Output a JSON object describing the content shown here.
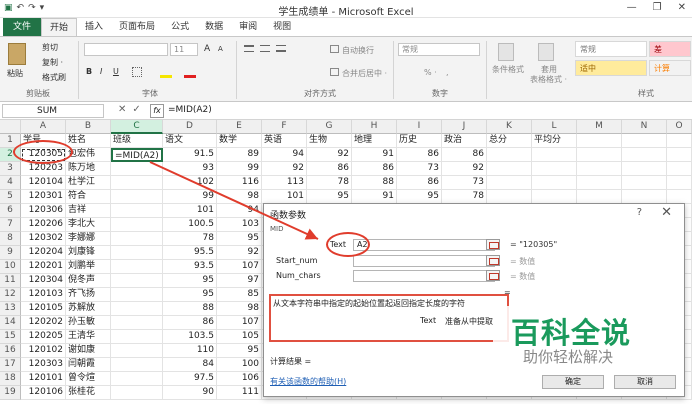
{
  "window": {
    "title": "学生成绩单 - Microsoft Excel",
    "minimize": "—",
    "restore": "❐",
    "close": "✕"
  },
  "qat": {
    "save": "▣",
    "undo": "↶",
    "redo": "↷",
    "more": "▾"
  },
  "tabs": [
    "文件",
    "开始",
    "插入",
    "页面布局",
    "公式",
    "数据",
    "审阅",
    "视图"
  ],
  "ribbon": {
    "paste": "粘贴",
    "cut": "剪切",
    "copy": "复制 ·",
    "format_painter": "格式刷",
    "font_size": "11",
    "bold": "B",
    "italic": "I",
    "underline": "U",
    "font_grow": "A",
    "font_shrink": "A",
    "wrap": "自动换行",
    "merge": "合并后居中 ·",
    "number_format": "常规",
    "percent": "% ·",
    "comma": ",",
    "cond_format": "条件格式",
    "table_format_1": "套用",
    "table_format_2": "表格格式 ·",
    "style_normal": "常规",
    "style_bad": "差",
    "style_neutral": "适中",
    "style_calc": "计算",
    "groups": {
      "clipboard": "剪贴板",
      "font": "字体",
      "align": "对齐方式",
      "number": "数字",
      "styles": "样式"
    }
  },
  "formula_bar": {
    "name_box": "SUM",
    "cancel": "✕",
    "enter": "✓",
    "fx": "fx",
    "formula": "=MID(A2)"
  },
  "columns": [
    "A",
    "B",
    "C",
    "D",
    "E",
    "F",
    "G",
    "H",
    "I",
    "J",
    "K",
    "L",
    "M",
    "N",
    "O"
  ],
  "rows": [
    [
      "学号",
      "姓名",
      "班级",
      "语文",
      "数学",
      "英语",
      "生物",
      "地理",
      "历史",
      "政治",
      "总分",
      "平均分"
    ],
    [
      "120305",
      "包宏伟",
      "=MID(A2)",
      "91.5",
      "89",
      "94",
      "92",
      "91",
      "86",
      "86",
      "",
      ""
    ],
    [
      "120203",
      "陈万地",
      "",
      "93",
      "99",
      "92",
      "86",
      "86",
      "73",
      "92",
      "",
      ""
    ],
    [
      "120104",
      "杜学江",
      "",
      "102",
      "116",
      "113",
      "78",
      "88",
      "86",
      "73",
      "",
      ""
    ],
    [
      "120301",
      "符合",
      "",
      "99",
      "98",
      "101",
      "95",
      "91",
      "95",
      "78",
      "",
      ""
    ],
    [
      "120306",
      "吉祥",
      "",
      "101",
      "94",
      "",
      "",
      "",
      "",
      "",
      "",
      ""
    ],
    [
      "120206",
      "李北大",
      "",
      "100.5",
      "103",
      "",
      "",
      "",
      "",
      "",
      "",
      ""
    ],
    [
      "120302",
      "李娜娜",
      "",
      "78",
      "95",
      "",
      "",
      "",
      "",
      "",
      "",
      ""
    ],
    [
      "120204",
      "刘康锋",
      "",
      "95.5",
      "92",
      "",
      "",
      "",
      "",
      "",
      "",
      ""
    ],
    [
      "120201",
      "刘鹏举",
      "",
      "93.5",
      "107",
      "",
      "",
      "",
      "",
      "",
      "",
      ""
    ],
    [
      "120304",
      "倪冬声",
      "",
      "95",
      "97",
      "",
      "",
      "",
      "",
      "",
      "",
      ""
    ],
    [
      "120103",
      "齐飞扬",
      "",
      "95",
      "85",
      "",
      "",
      "",
      "",
      "",
      "",
      ""
    ],
    [
      "120105",
      "苏解放",
      "",
      "88",
      "98",
      "",
      "",
      "",
      "",
      "",
      "",
      ""
    ],
    [
      "120202",
      "孙玉敏",
      "",
      "86",
      "107",
      "",
      "",
      "",
      "",
      "",
      "",
      ""
    ],
    [
      "120205",
      "王清华",
      "",
      "103.5",
      "105",
      "",
      "",
      "",
      "",
      "",
      "",
      ""
    ],
    [
      "120102",
      "谢如康",
      "",
      "110",
      "95",
      "",
      "",
      "",
      "",
      "",
      "",
      ""
    ],
    [
      "120303",
      "闫朝霞",
      "",
      "84",
      "100",
      "",
      "",
      "",
      "",
      "",
      "",
      ""
    ],
    [
      "120101",
      "曾令煊",
      "",
      "97.5",
      "106",
      "",
      "",
      "",
      "",
      "",
      "",
      ""
    ],
    [
      "120106",
      "张桂花",
      "",
      "90",
      "111",
      "",
      "",
      "",
      "",
      "",
      "",
      ""
    ]
  ],
  "dialog": {
    "title": "函数参数",
    "help": "?",
    "close": "✕",
    "func_name": "MID",
    "args": [
      {
        "label": "Text",
        "value": "A2",
        "result": "= \"120305\""
      },
      {
        "label": "Start_num",
        "value": "",
        "result": "= 数值"
      },
      {
        "label": "Num_chars",
        "value": "",
        "result": "= 数值"
      }
    ],
    "result_eq": "=",
    "description": "从文本字符串中指定的起始位置起返回指定长度的字符",
    "arg_desc_label": "Text",
    "arg_desc": "准备从中提取",
    "calc_result": "计算结果 =",
    "help_link": "有关该函数的帮助(H)",
    "ok": "确定",
    "cancel": "取消"
  },
  "watermark": {
    "line1": "百科全说",
    "line2": "助你轻松解决"
  },
  "colors": {
    "excel_green": "#217346",
    "annotation_red": "#e03c2c",
    "watermark_green": "#1a9a5c"
  }
}
